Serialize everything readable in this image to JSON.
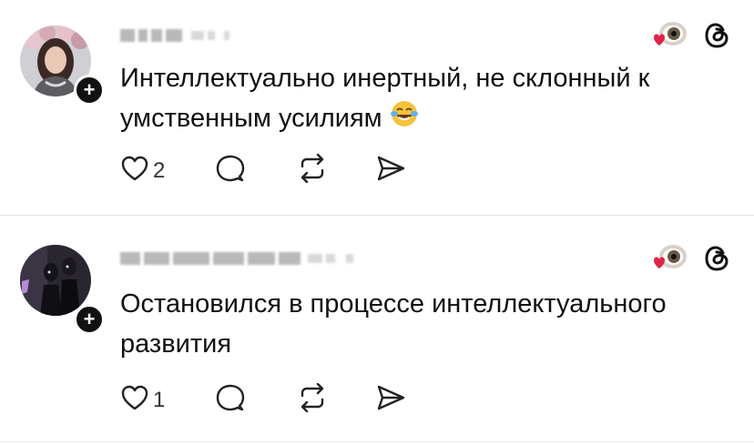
{
  "posts": [
    {
      "text": "Интеллектуально инертный, не склонный к умственным усилиям",
      "emoji": "joy-tears-emoji",
      "likes": "2",
      "username": "blurred"
    },
    {
      "text": "Остановился в процессе интеллектуального развития",
      "likes": "1",
      "username": "blurred"
    }
  ],
  "icons": {
    "like": "heart-outline-icon",
    "reply": "speech-bubble-icon",
    "repost": "repost-arrows-icon",
    "share": "send-icon",
    "app": "threads-logo-icon",
    "react": "eye-heart-sticker-icon",
    "follow": "plus-icon"
  },
  "colors": {
    "text": "#111111",
    "heart": "#e0234a",
    "divider": "#e3e3e3"
  }
}
